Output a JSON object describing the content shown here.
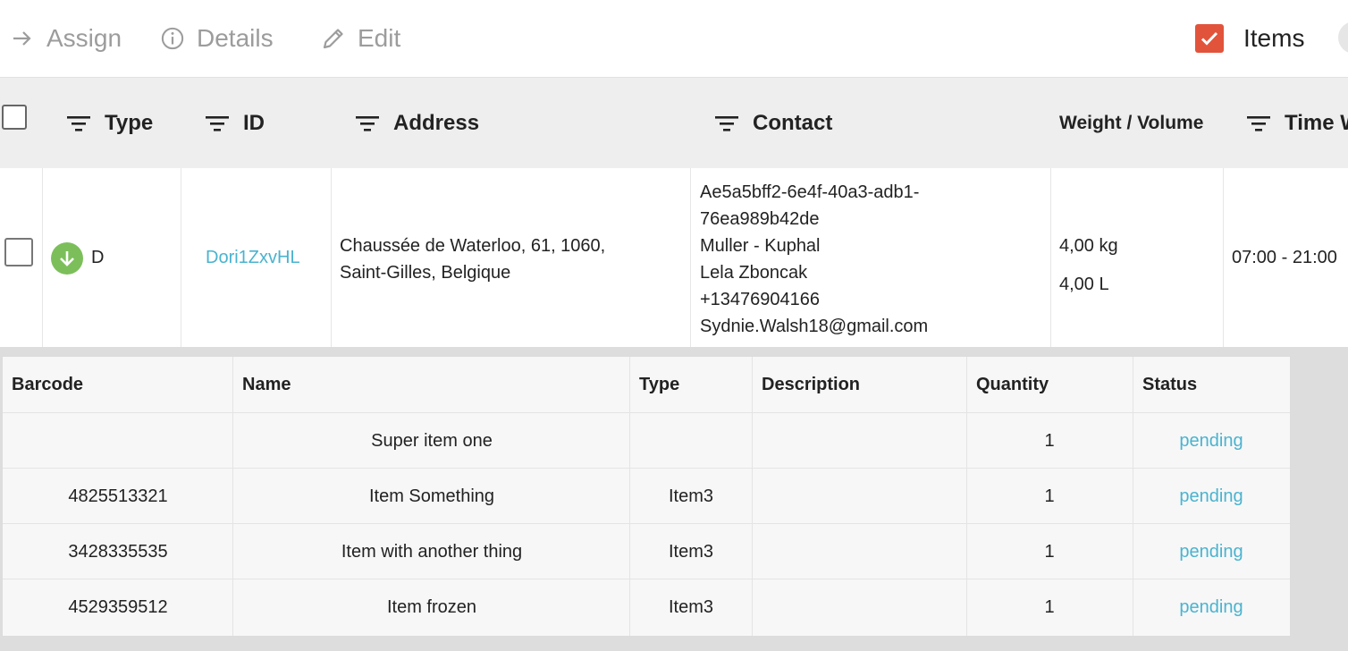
{
  "toolbar": {
    "assign": "Assign",
    "details": "Details",
    "edit": "Edit",
    "items_toggle": "Items"
  },
  "columns": {
    "type": "Type",
    "id": "ID",
    "address": "Address",
    "contact": "Contact",
    "weight_volume": "Weight / Volume",
    "time_window": "Time W"
  },
  "row": {
    "type": "D",
    "id": "Dori1ZxvHL",
    "address": [
      "Chaussée de Waterloo, 61, 1060,",
      "Saint-Gilles, Belgique"
    ],
    "contact": [
      "Ae5a5bff2-6e4f-40a3-adb1-",
      "76ea989b42de",
      "Muller - Kuphal",
      "Lela Zboncak",
      "+13476904166",
      "Sydnie.Walsh18@gmail.com"
    ],
    "weight": "4,00 kg",
    "volume": "4,00 L",
    "time_window": "07:00 - 21:00"
  },
  "items_table": {
    "headers": [
      "Barcode",
      "Name",
      "Type",
      "Description",
      "Quantity",
      "Status"
    ],
    "rows": [
      {
        "barcode": "",
        "name": "Super item one",
        "type": "",
        "description": "",
        "quantity": "1",
        "status": "pending"
      },
      {
        "barcode": "4825513321",
        "name": "Item Something",
        "type": "Item3",
        "description": "",
        "quantity": "1",
        "status": "pending"
      },
      {
        "barcode": "3428335535",
        "name": "Item with another thing",
        "type": "Item3",
        "description": "",
        "quantity": "1",
        "status": "pending"
      },
      {
        "barcode": "4529359512",
        "name": "Item frozen",
        "type": "Item3",
        "description": "",
        "quantity": "1",
        "status": "pending"
      }
    ]
  },
  "colors": {
    "accent": "#4ab3cf",
    "checkbox": "#e2533c",
    "delivery_badge": "#7cbf5a"
  }
}
